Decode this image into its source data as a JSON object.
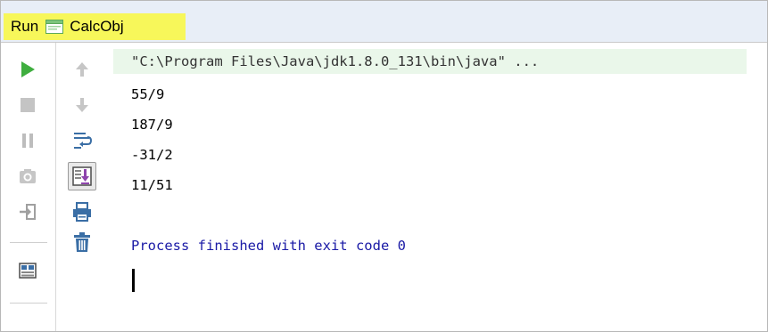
{
  "titlebar": {
    "tab_label": "Run",
    "config_name": "CalcObj",
    "config_icon": "application-config-icon"
  },
  "toolbar": {
    "left_column": [
      {
        "name": "rerun-icon",
        "color": "#3fae3f"
      },
      {
        "name": "stop-icon",
        "color": "#b8b8b8"
      },
      {
        "name": "pause-icon",
        "color": "#b8b8b8"
      },
      {
        "name": "dump-threads-icon",
        "color": "#b8b8b8"
      },
      {
        "name": "exit-icon",
        "color": "#9a9a9a"
      },
      {
        "name": "restore-layout-icon",
        "color": "#3a6ea5"
      }
    ],
    "right_column": [
      {
        "name": "up-arrow-icon",
        "color": "#bdbdbd"
      },
      {
        "name": "down-arrow-icon",
        "color": "#bdbdbd"
      },
      {
        "name": "soft-wrap-icon",
        "color": "#3a6ea5"
      },
      {
        "name": "scroll-to-end-icon",
        "color": "#8e44ad",
        "active": true
      },
      {
        "name": "print-icon",
        "color": "#3a6ea5"
      },
      {
        "name": "clear-all-icon",
        "color": "#3a6ea5"
      }
    ]
  },
  "console": {
    "command": "\"C:\\Program Files\\Java\\jdk1.8.0_131\\bin\\java\" ...",
    "output": [
      "55/9",
      "187/9",
      "-31/2",
      "11/51"
    ],
    "exit_message": "Process finished with exit code 0"
  },
  "colors": {
    "tab_highlight": "#f7f75a",
    "command_bg": "#eaf7ea",
    "exit_text": "#1a1aa6",
    "titlebar_bg": "#e8eef7"
  }
}
